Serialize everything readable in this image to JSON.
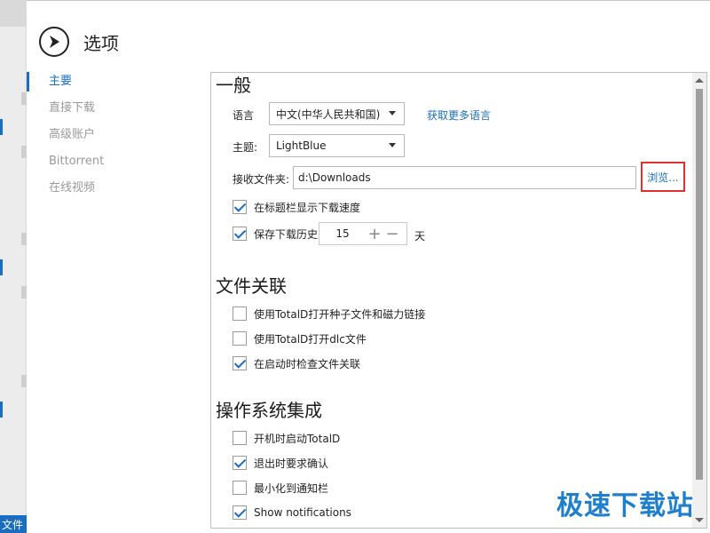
{
  "background": {
    "footer_text": "文件"
  },
  "dialog": {
    "title": "选项"
  },
  "nav": {
    "items": [
      {
        "label": "主要"
      },
      {
        "label": "直接下载"
      },
      {
        "label": "高级账户"
      },
      {
        "label": "Bittorrent"
      },
      {
        "label": "在线视频"
      }
    ]
  },
  "general": {
    "section_title": "一般",
    "language_label": "语言",
    "language_value": "中文(中华人民共和国)",
    "more_languages_link": "获取更多语言",
    "theme_label": "主题:",
    "theme_value": "LightBlue",
    "folder_label": "接收文件夹:",
    "folder_value": "d:\\Downloads",
    "browse_label": "浏览...",
    "show_speed_label": "在标题栏显示下载速度",
    "show_speed_checked": true,
    "keep_history_label": "保存下载历史",
    "keep_history_checked": true,
    "history_days": "15",
    "days_unit": "天"
  },
  "file_assoc": {
    "section_title": "文件关联",
    "items": [
      {
        "label": "使用TotalD打开种子文件和磁力链接",
        "checked": false
      },
      {
        "label": "使用TotalD打开dlc文件",
        "checked": false
      },
      {
        "label": "在启动时检查文件关联",
        "checked": true
      }
    ]
  },
  "os_integration": {
    "section_title": "操作系统集成",
    "items": [
      {
        "label": "开机时启动TotalD",
        "checked": false
      },
      {
        "label": "退出时要求确认",
        "checked": true
      },
      {
        "label": "最小化到通知栏",
        "checked": false
      },
      {
        "label": "Show notifications",
        "checked": true
      }
    ]
  },
  "watermark": "极速下载站",
  "colors": {
    "accent": "#1a6ec1",
    "highlight_box": "#e0302e"
  }
}
